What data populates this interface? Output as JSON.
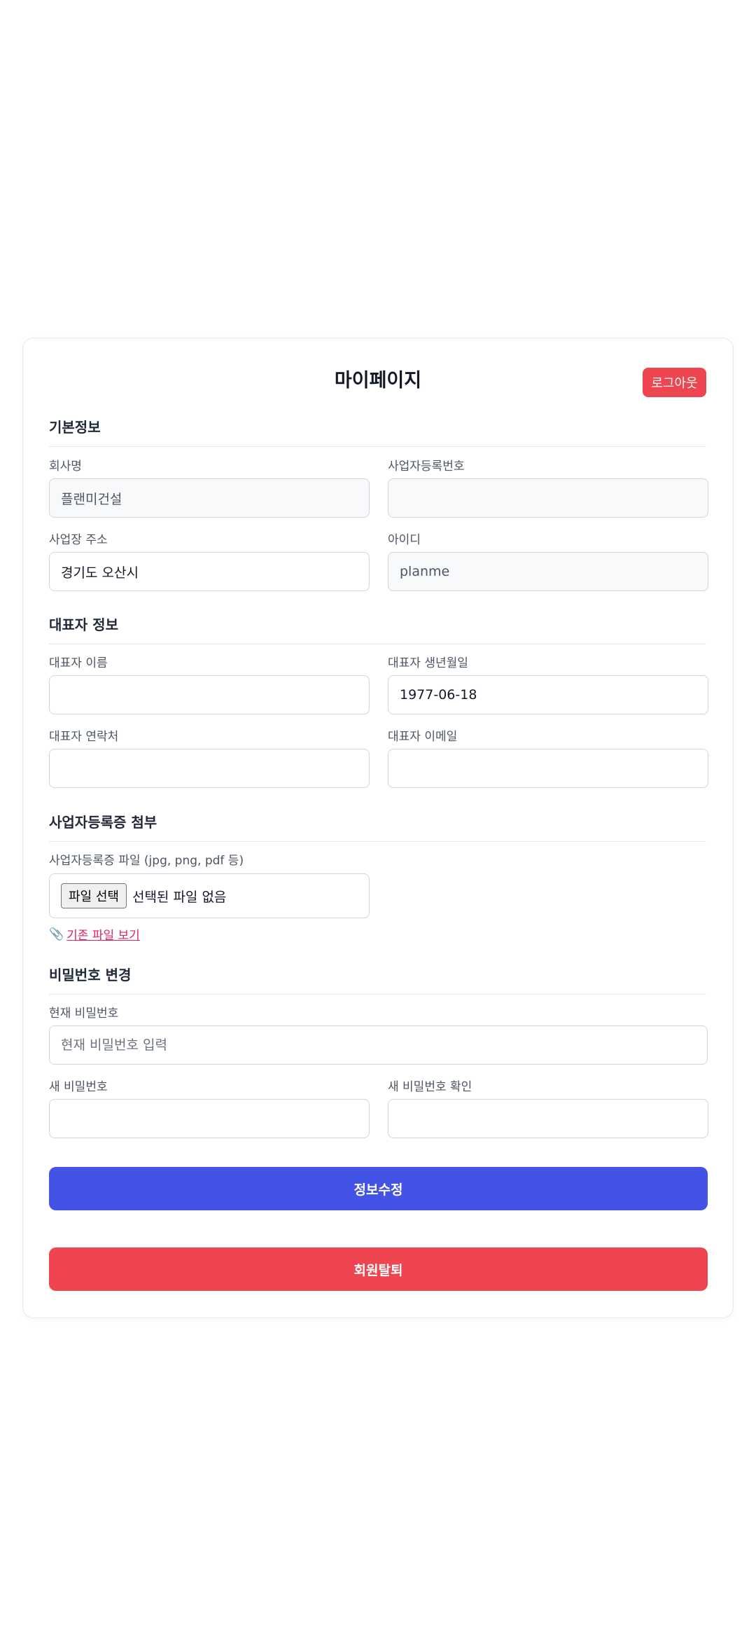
{
  "header": {
    "title": "마이페이지",
    "logout_label": "로그아웃"
  },
  "basic_info": {
    "section_title": "기본정보",
    "company_name": {
      "label": "회사명",
      "value": "플랜미건설"
    },
    "business_reg_no": {
      "label": "사업자등록번호",
      "value": ""
    },
    "business_address": {
      "label": "사업장 주소",
      "value": "경기도 오산시"
    },
    "user_id": {
      "label": "아이디",
      "value": "planme"
    }
  },
  "ceo_info": {
    "section_title": "대표자 정보",
    "ceo_name": {
      "label": "대표자 이름",
      "value": ""
    },
    "ceo_birthdate": {
      "label": "대표자 생년월일",
      "value": "1977-06-18"
    },
    "ceo_phone": {
      "label": "대표자 연락처",
      "value": ""
    },
    "ceo_email": {
      "label": "대표자 이메일",
      "value": ""
    }
  },
  "attachment": {
    "section_title": "사업자등록증 첨부",
    "file_label": "사업자등록증 파일 (jpg, png, pdf 등)",
    "choose_file_label": "파일 선택",
    "no_file_text": "선택된 파일 없음",
    "existing_file_link": "기존 파일 보기",
    "link_icon": "paperclip-icon"
  },
  "password": {
    "section_title": "비밀번호 변경",
    "current": {
      "label": "현재 비밀번호",
      "placeholder": "현재 비밀번호 입력",
      "value": ""
    },
    "new": {
      "label": "새 비밀번호",
      "value": ""
    },
    "confirm": {
      "label": "새 비밀번호 확인",
      "value": ""
    }
  },
  "actions": {
    "update_label": "정보수정",
    "withdraw_label": "회원탈퇴"
  },
  "colors": {
    "primary": "#4353e6",
    "danger": "#ef4550",
    "link": "#e0245e"
  }
}
